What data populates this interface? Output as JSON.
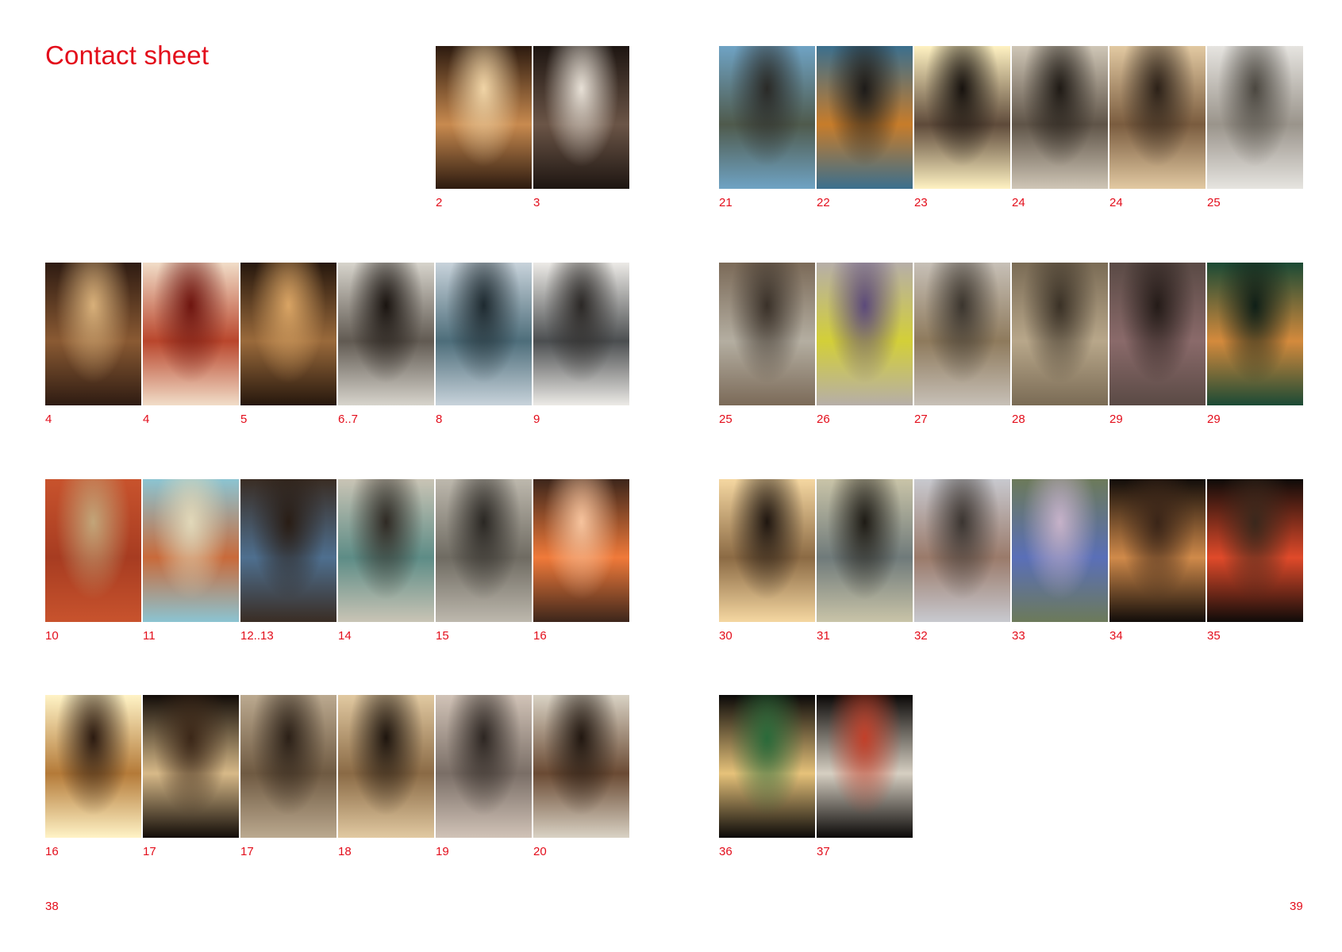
{
  "heading": "Contact sheet",
  "folio": {
    "left": "38",
    "right": "39"
  },
  "left_page": {
    "rows": [
      [
        {
          "slot": 4,
          "caption": "2",
          "scene": "cafe window seat",
          "colors": [
            "#2c1a0f",
            "#c88a4f",
            "#f0d4a6"
          ]
        },
        {
          "slot": 5,
          "caption": "3",
          "scene": "coffee glass on marble",
          "colors": [
            "#1d1511",
            "#6b5547",
            "#e7e0d6"
          ]
        }
      ],
      [
        {
          "slot": 0,
          "caption": "4",
          "scene": "cafe shelves",
          "colors": [
            "#2e1b12",
            "#8a5a33",
            "#d8b07a"
          ]
        },
        {
          "slot": 1,
          "caption": "4",
          "scene": "red coffee cup",
          "colors": [
            "#f1ddc8",
            "#b9462c",
            "#6e150f"
          ]
        },
        {
          "slot": 2,
          "caption": "5",
          "scene": "shop interior plants",
          "colors": [
            "#26170d",
            "#9a6a3b",
            "#d9a464"
          ]
        },
        {
          "slot": 3,
          "caption": "6..7",
          "scene": "river building haze",
          "colors": [
            "#d7d4cc",
            "#615a52",
            "#1a1410"
          ]
        },
        {
          "slot": 4,
          "caption": "8",
          "scene": "glass office facade",
          "colors": [
            "#c8d3db",
            "#4d6d7a",
            "#1e2a30"
          ]
        },
        {
          "slot": 5,
          "caption": "9",
          "scene": "grey office block",
          "colors": [
            "#eceae6",
            "#4b4e50",
            "#2b2826"
          ]
        }
      ],
      [
        {
          "slot": 0,
          "caption": "10",
          "scene": "orange subway station",
          "colors": [
            "#c8532d",
            "#a73c21",
            "#c2a579"
          ]
        },
        {
          "slot": 1,
          "caption": "11",
          "scene": "tv tower ferris wheel",
          "colors": [
            "#8bc4d2",
            "#c96a3a",
            "#e1d8b9"
          ]
        },
        {
          "slot": 2,
          "caption": "12..13",
          "scene": "blue sky walls",
          "colors": [
            "#3a2d24",
            "#4e6f8f",
            "#291d15"
          ]
        },
        {
          "slot": 3,
          "caption": "14",
          "scene": "woman and scooter",
          "colors": [
            "#c9c4b5",
            "#5d8c86",
            "#2f2a24"
          ]
        },
        {
          "slot": 4,
          "caption": "15",
          "scene": "street with dog",
          "colors": [
            "#bdb8ad",
            "#6f6b62",
            "#2a2723"
          ]
        },
        {
          "slot": 5,
          "caption": "16",
          "scene": "orange lamp",
          "colors": [
            "#3d261b",
            "#f07a3a",
            "#f6c39d"
          ]
        }
      ],
      [
        {
          "slot": 0,
          "caption": "16",
          "scene": "sunburst towers",
          "colors": [
            "#fff3c6",
            "#b47a38",
            "#2b1a10"
          ]
        },
        {
          "slot": 1,
          "caption": "17",
          "scene": "sunlit passage",
          "colors": [
            "#120c08",
            "#d7b988",
            "#3b2718"
          ]
        },
        {
          "slot": 2,
          "caption": "17",
          "scene": "construction lights",
          "colors": [
            "#bba98f",
            "#6f5a42",
            "#2b2017"
          ]
        },
        {
          "slot": 3,
          "caption": "18",
          "scene": "backlit walkers",
          "colors": [
            "#e1c9a1",
            "#8a6a45",
            "#1e150e"
          ]
        },
        {
          "slot": 4,
          "caption": "19",
          "scene": "red haired woman",
          "colors": [
            "#d1c3b7",
            "#7a6e66",
            "#2d2622"
          ]
        },
        {
          "slot": 5,
          "caption": "20",
          "scene": "train bridge sky",
          "colors": [
            "#d9d2c4",
            "#6a4a33",
            "#211710"
          ]
        }
      ]
    ]
  },
  "right_page": {
    "rows": [
      [
        {
          "slot": 0,
          "caption": "21",
          "scene": "street signs",
          "colors": [
            "#6fa3c4",
            "#4f5a4c",
            "#2a2a27"
          ]
        },
        {
          "slot": 1,
          "caption": "22",
          "scene": "yellow s-bahn train",
          "colors": [
            "#3b6f8e",
            "#c77c2a",
            "#1d1b19"
          ]
        },
        {
          "slot": 2,
          "caption": "23",
          "scene": "sun flare street",
          "colors": [
            "#fff2c2",
            "#5e4a3a",
            "#17120e"
          ]
        },
        {
          "slot": 3,
          "caption": "24",
          "scene": "bookstore window",
          "colors": [
            "#cfc6b6",
            "#5f5448",
            "#1f1a15"
          ]
        },
        {
          "slot": 4,
          "caption": "24",
          "scene": "bookstore interior",
          "colors": [
            "#e2c9a2",
            "#7a5c3f",
            "#2c2118"
          ]
        },
        {
          "slot": 5,
          "caption": "25",
          "scene": "white townhouse",
          "colors": [
            "#e6e4e0",
            "#9a948b",
            "#4b4740"
          ]
        }
      ],
      [
        {
          "slot": 0,
          "caption": "25",
          "scene": "shop entrance",
          "colors": [
            "#7b6a58",
            "#b4aea1",
            "#3a3129"
          ]
        },
        {
          "slot": 1,
          "caption": "26",
          "scene": "graffiti van",
          "colors": [
            "#b6aea8",
            "#d3cf38",
            "#5c4a7a"
          ]
        },
        {
          "slot": 2,
          "caption": "27",
          "scene": "cyclist graffiti",
          "colors": [
            "#c7c0b7",
            "#8e7a5c",
            "#3b352e"
          ]
        },
        {
          "slot": 3,
          "caption": "28",
          "scene": "under the tracks",
          "colors": [
            "#7a6b55",
            "#b8a78a",
            "#3a3126"
          ]
        },
        {
          "slot": 4,
          "caption": "29",
          "scene": "crowd under bridge",
          "colors": [
            "#5a4a45",
            "#8a6a6a",
            "#241b18"
          ]
        },
        {
          "slot": 5,
          "caption": "29",
          "scene": "green station kiosk",
          "colors": [
            "#1b4a35",
            "#d48a3c",
            "#0f1f17"
          ]
        }
      ],
      [
        {
          "slot": 0,
          "caption": "30",
          "scene": "evening sun pillars",
          "colors": [
            "#f5d7a1",
            "#8b6a44",
            "#1f1610"
          ]
        },
        {
          "slot": 1,
          "caption": "31",
          "scene": "bridge silhouette",
          "colors": [
            "#c9c4a8",
            "#6f7a7a",
            "#1e1b15"
          ]
        },
        {
          "slot": 2,
          "caption": "32",
          "scene": "ornate building canal",
          "colors": [
            "#c8c9cf",
            "#9a7a6a",
            "#3b3531"
          ]
        },
        {
          "slot": 3,
          "caption": "33",
          "scene": "swans on canal",
          "colors": [
            "#6c7a5a",
            "#5a6fb8",
            "#c6b2c9"
          ]
        },
        {
          "slot": 4,
          "caption": "34",
          "scene": "bar lights",
          "colors": [
            "#120d0a",
            "#d08a4a",
            "#3a2518"
          ]
        },
        {
          "slot": 5,
          "caption": "35",
          "scene": "neon bar",
          "colors": [
            "#0f0b09",
            "#e04a2a",
            "#3a281c"
          ]
        }
      ],
      [
        {
          "slot": 0,
          "caption": "36",
          "scene": "night cinema sign",
          "colors": [
            "#0b0908",
            "#e6c27a",
            "#2a6a3a"
          ]
        },
        {
          "slot": 1,
          "caption": "37",
          "scene": "night club entrance",
          "colors": [
            "#0a0807",
            "#d6cfc2",
            "#c2402a"
          ]
        }
      ]
    ]
  }
}
